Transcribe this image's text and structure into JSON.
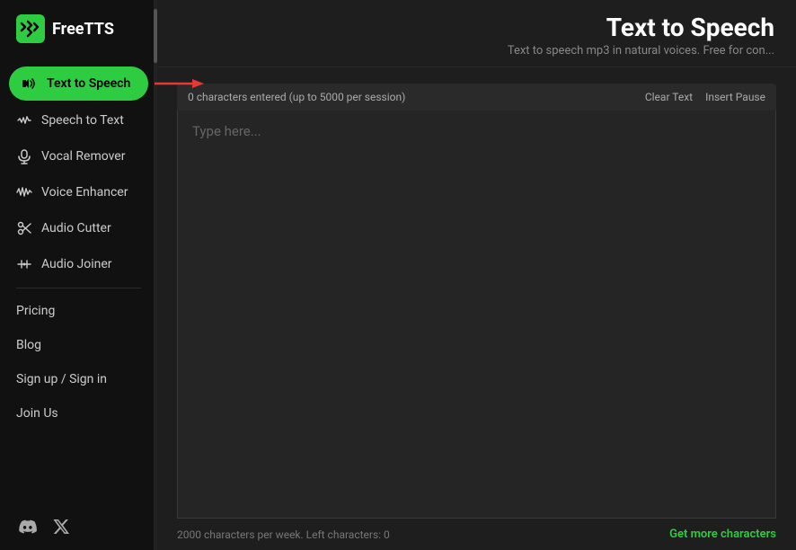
{
  "app": {
    "name": "FreeTTS",
    "logo_alt": "FreeTTS logo"
  },
  "sidebar": {
    "nav_items": [
      {
        "id": "text-to-speech",
        "label": "Text to Speech",
        "icon": "tts-icon",
        "active": true
      },
      {
        "id": "speech-to-text",
        "label": "Speech to Text",
        "icon": "stt-icon",
        "active": false
      },
      {
        "id": "vocal-remover",
        "label": "Vocal Remover",
        "icon": "mic-icon",
        "active": false
      },
      {
        "id": "voice-enhancer",
        "label": "Voice Enhancer",
        "icon": "enhance-icon",
        "active": false
      },
      {
        "id": "audio-cutter",
        "label": "Audio Cutter",
        "icon": "cutter-icon",
        "active": false
      },
      {
        "id": "audio-joiner",
        "label": "Audio Joiner",
        "icon": "joiner-icon",
        "active": false
      }
    ],
    "text_items": [
      {
        "id": "pricing",
        "label": "Pricing"
      },
      {
        "id": "blog",
        "label": "Blog"
      },
      {
        "id": "signup",
        "label": "Sign up / Sign in"
      },
      {
        "id": "join-us",
        "label": "Join Us"
      }
    ]
  },
  "main": {
    "title": "Text to Speech",
    "subtitle": "Text to speech mp3 in natural voices. Free for con...",
    "char_status": "0 characters entered (up to 5000 per session)",
    "clear_text_btn": "Clear Text",
    "insert_pause_btn": "Insert Pause",
    "placeholder": "Type here...",
    "footer_char_info": "2000 characters per week. Left characters: 0",
    "get_more_label": "Get more characters"
  }
}
